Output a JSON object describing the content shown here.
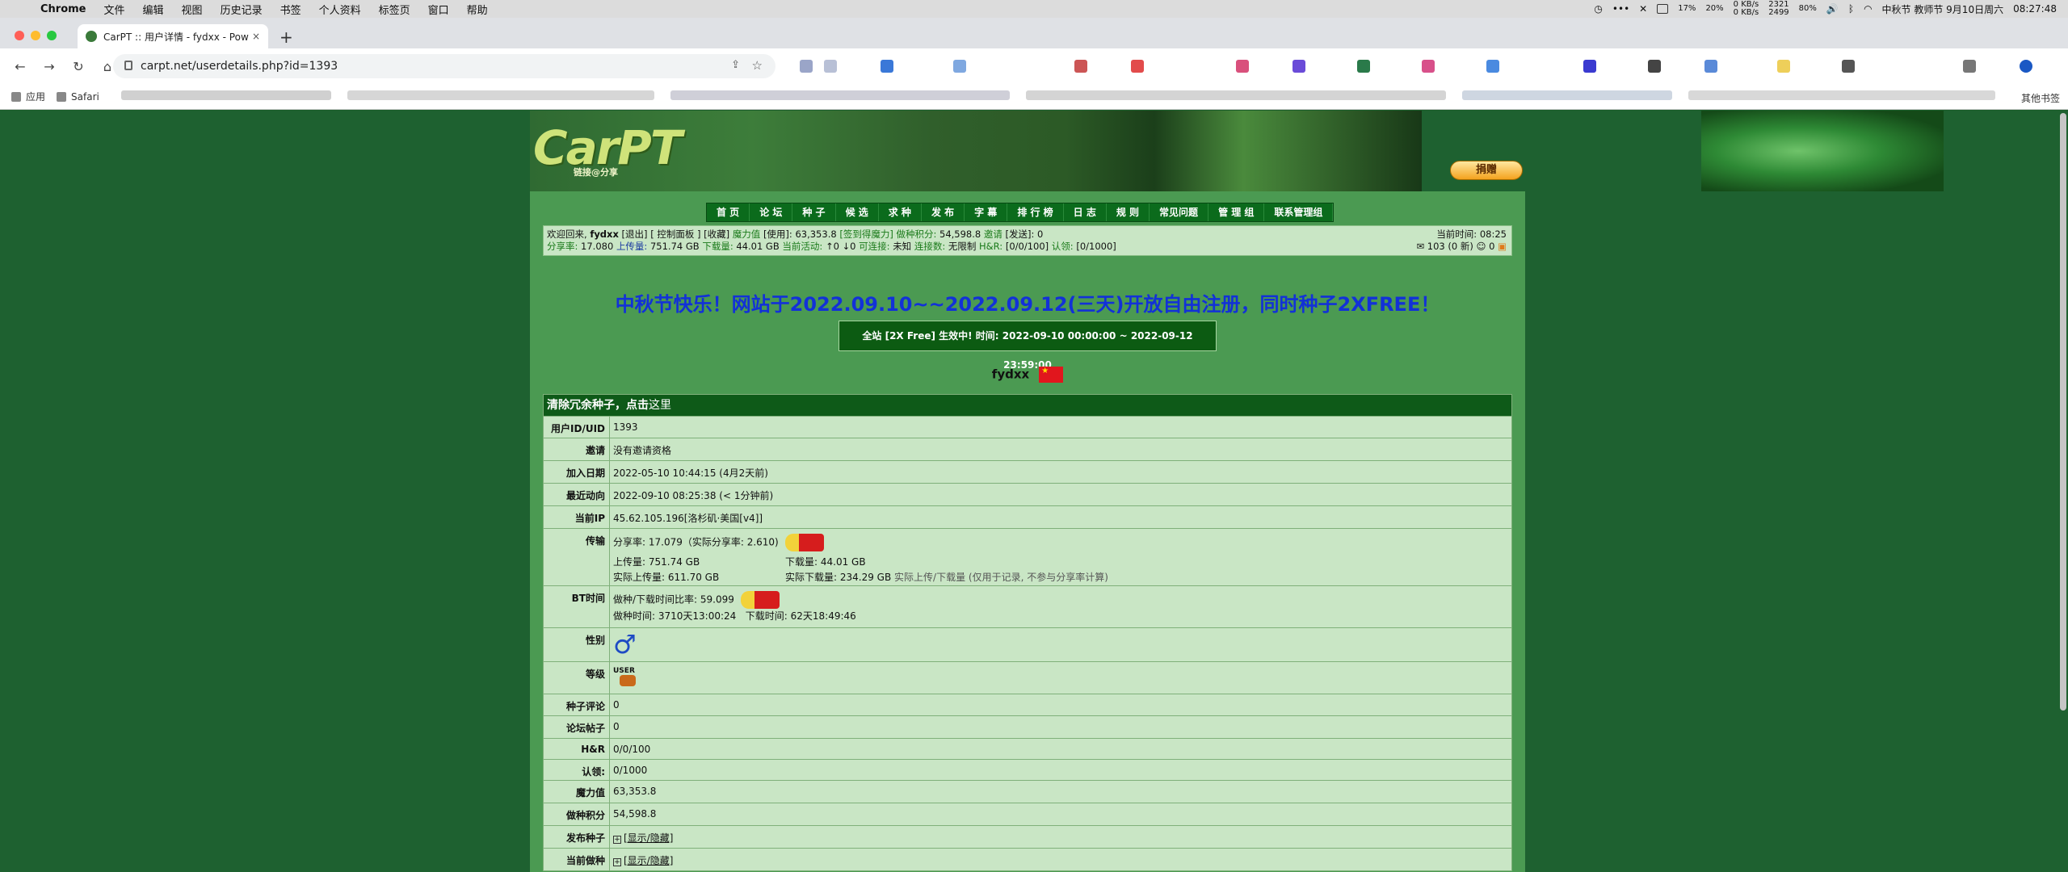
{
  "menubar": {
    "app": "Chrome",
    "items": [
      "文件",
      "编辑",
      "视图",
      "历史记录",
      "书签",
      "个人资料",
      "标签页",
      "窗口",
      "帮助"
    ],
    "cpu": "17%",
    "gpu": "20%",
    "net_up": "0 KB/s",
    "net_down": "0 KB/s",
    "stat1": "2321",
    "stat2": "2499",
    "stat3": "80%",
    "datetime": "中秋节 教师节 9月10日周六",
    "time": "08:27:48"
  },
  "tab": {
    "title": "CarPT :: 用户详情 - fydxx - Pow",
    "close": "×",
    "new_tab": "+"
  },
  "address": {
    "url": "carpt.net/userdetails.php?id=1393"
  },
  "bookmarks": {
    "apps": "应用",
    "safari": "Safari",
    "other": "其他书签"
  },
  "site": {
    "logo": "CarPT",
    "logo_sub": "链接@分享",
    "donate": "捐赠"
  },
  "nav": [
    "首 页",
    "论 坛",
    "种 子",
    "候 选",
    "求 种",
    "发 布",
    "字 幕",
    "排 行 榜",
    "日 志",
    "规 则",
    "常见问题",
    "管 理 组",
    "联系管理组"
  ],
  "info": {
    "welcome": "欢迎回来,",
    "user": "fydxx",
    "logout": "[退出]",
    "panel": "[ 控制面板 ]",
    "fav": "[收藏]",
    "magic_label": "魔力值",
    "magic_use": "[使用]:",
    "magic_val": "63,353.8",
    "signin": "[签到得魔力]",
    "seed_score_label": "做种积分:",
    "seed_score": "54,598.8",
    "invite_label": "邀请",
    "invite": "[发送]:",
    "invite_val": "0",
    "ratio_label": "分享率:",
    "ratio": "17.080",
    "up_label": "上传量:",
    "up": "751.74 GB",
    "down_label": "下载量:",
    "down": "44.01 GB",
    "active_label": "当前活动:",
    "active": "↑0 ↓0",
    "connect_label": "可连接:",
    "connect": "未知",
    "conn_count_label": "连接数:",
    "conn_count": "无限制",
    "hr_label": "H&R:",
    "hr": "[0/0/100]",
    "claim_label": "认领:",
    "claim": "[0/1000]",
    "time_label": "当前时间:",
    "time": "08:25",
    "msgs": "103 (0 新)",
    "friends": "0"
  },
  "announce": "中秋节快乐！网站于2022.09.10~~2022.09.12(三天)开放自由注册，同时种子2XFREE！",
  "freebox": "全站 [2X Free] 生效中! 时间: 2022-09-10 00:00:00 ~ 2022-09-12 23:59:00",
  "username": "fydxx",
  "table": {
    "head": "清除冗余种子，点击",
    "head_link": "这里",
    "rows": [
      {
        "k": "用户ID/UID",
        "v": "1393"
      },
      {
        "k": "邀请",
        "v": "没有邀请资格"
      },
      {
        "k": "加入日期",
        "v": "2022-05-10 10:44:15 (4月2天前)"
      },
      {
        "k": "最近动向",
        "v": "2022-09-10 08:25:38 (< 1分钟前)"
      },
      {
        "k": "当前IP",
        "v": "45.62.105.196[洛杉矶·美国[v4]]"
      }
    ],
    "transfer": {
      "k": "传输",
      "ratio": "分享率: 17.079（实际分享率: 2.610)",
      "up": "上传量: 751.74 GB",
      "down": "下载量: 44.01 GB",
      "real_up": "实际上传量: 611.70 GB",
      "real_down": "实际下载量: 234.29 GB",
      "note": "实际上传/下载量 (仅用于记录, 不参与分享率计算)"
    },
    "bt": {
      "k": "BT时间",
      "ratio": "做种/下载时间比率: 59.099",
      "seed": "做种时间: 3710天13:00:24",
      "dl": "下载时间: 62天18:49:46"
    },
    "gender": {
      "k": "性别",
      "v": "♂"
    },
    "level": {
      "k": "等级",
      "v": "USER"
    },
    "rows2": [
      {
        "k": "种子评论",
        "v": "0"
      },
      {
        "k": "论坛帖子",
        "v": "0"
      },
      {
        "k": "H&R",
        "v": "0/0/100"
      },
      {
        "k": "认领:",
        "v": "0/1000"
      },
      {
        "k": "魔力值",
        "v": "63,353.8"
      },
      {
        "k": "做种积分",
        "v": "54,598.8"
      }
    ],
    "rows3": [
      {
        "k": "发布种子",
        "v": "[显示/隐藏]"
      },
      {
        "k": "当前做种",
        "v": "[显示/隐藏]"
      }
    ]
  }
}
